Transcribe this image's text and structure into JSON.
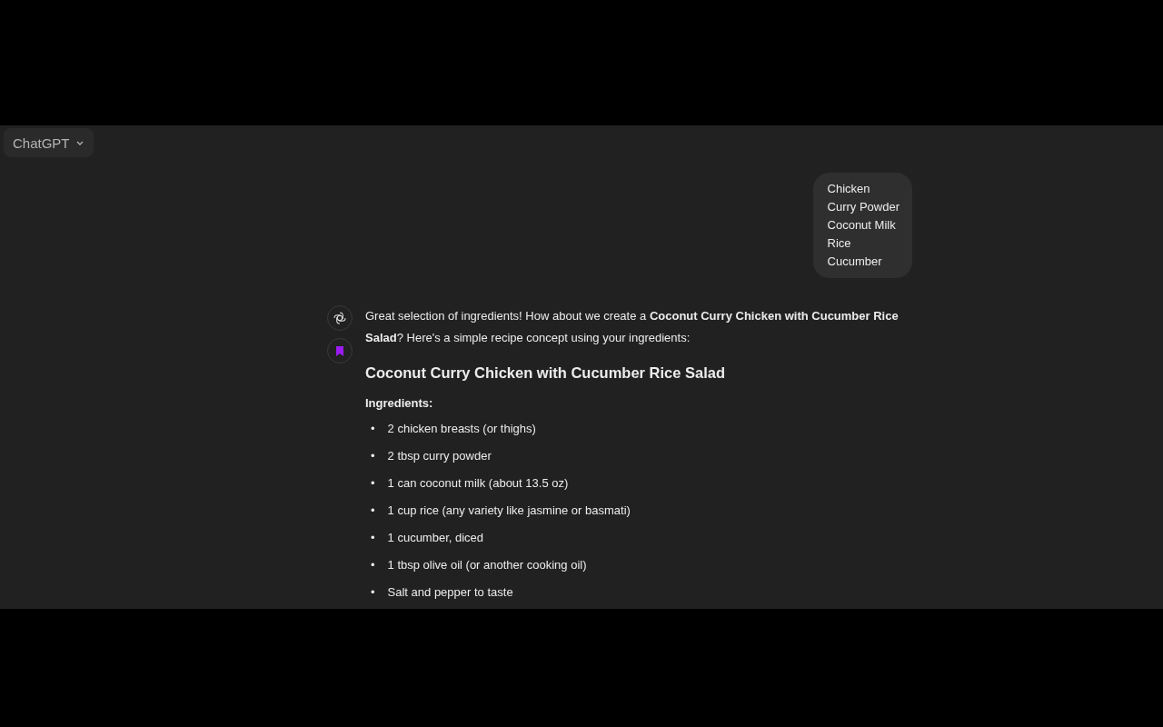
{
  "header": {
    "model_button": "ChatGPT"
  },
  "user_message": {
    "lines": [
      "Chicken",
      "Curry Powder",
      "Coconut Milk",
      "Rice",
      "Cucumber"
    ]
  },
  "assistant_message": {
    "intro": "Great selection of ingredients! How about we create a **Coconut Curry Chicken with Cucumber Rice Salad**? Here's a simple recipe concept using your ingredients:",
    "heading": "Coconut Curry Chicken with Cucumber Rice Salad",
    "section_label": "Ingredients:",
    "bullet": "•",
    "ingredients": [
      "2 chicken breasts (or thighs)",
      "2 tbsp curry powder",
      "1 can coconut milk (about 13.5 oz)",
      "1 cup rice (any variety like jasmine or basmati)",
      "1 cucumber, diced",
      "1 tbsp olive oil (or another cooking oil)",
      "Salt and pepper to taste"
    ]
  }
}
